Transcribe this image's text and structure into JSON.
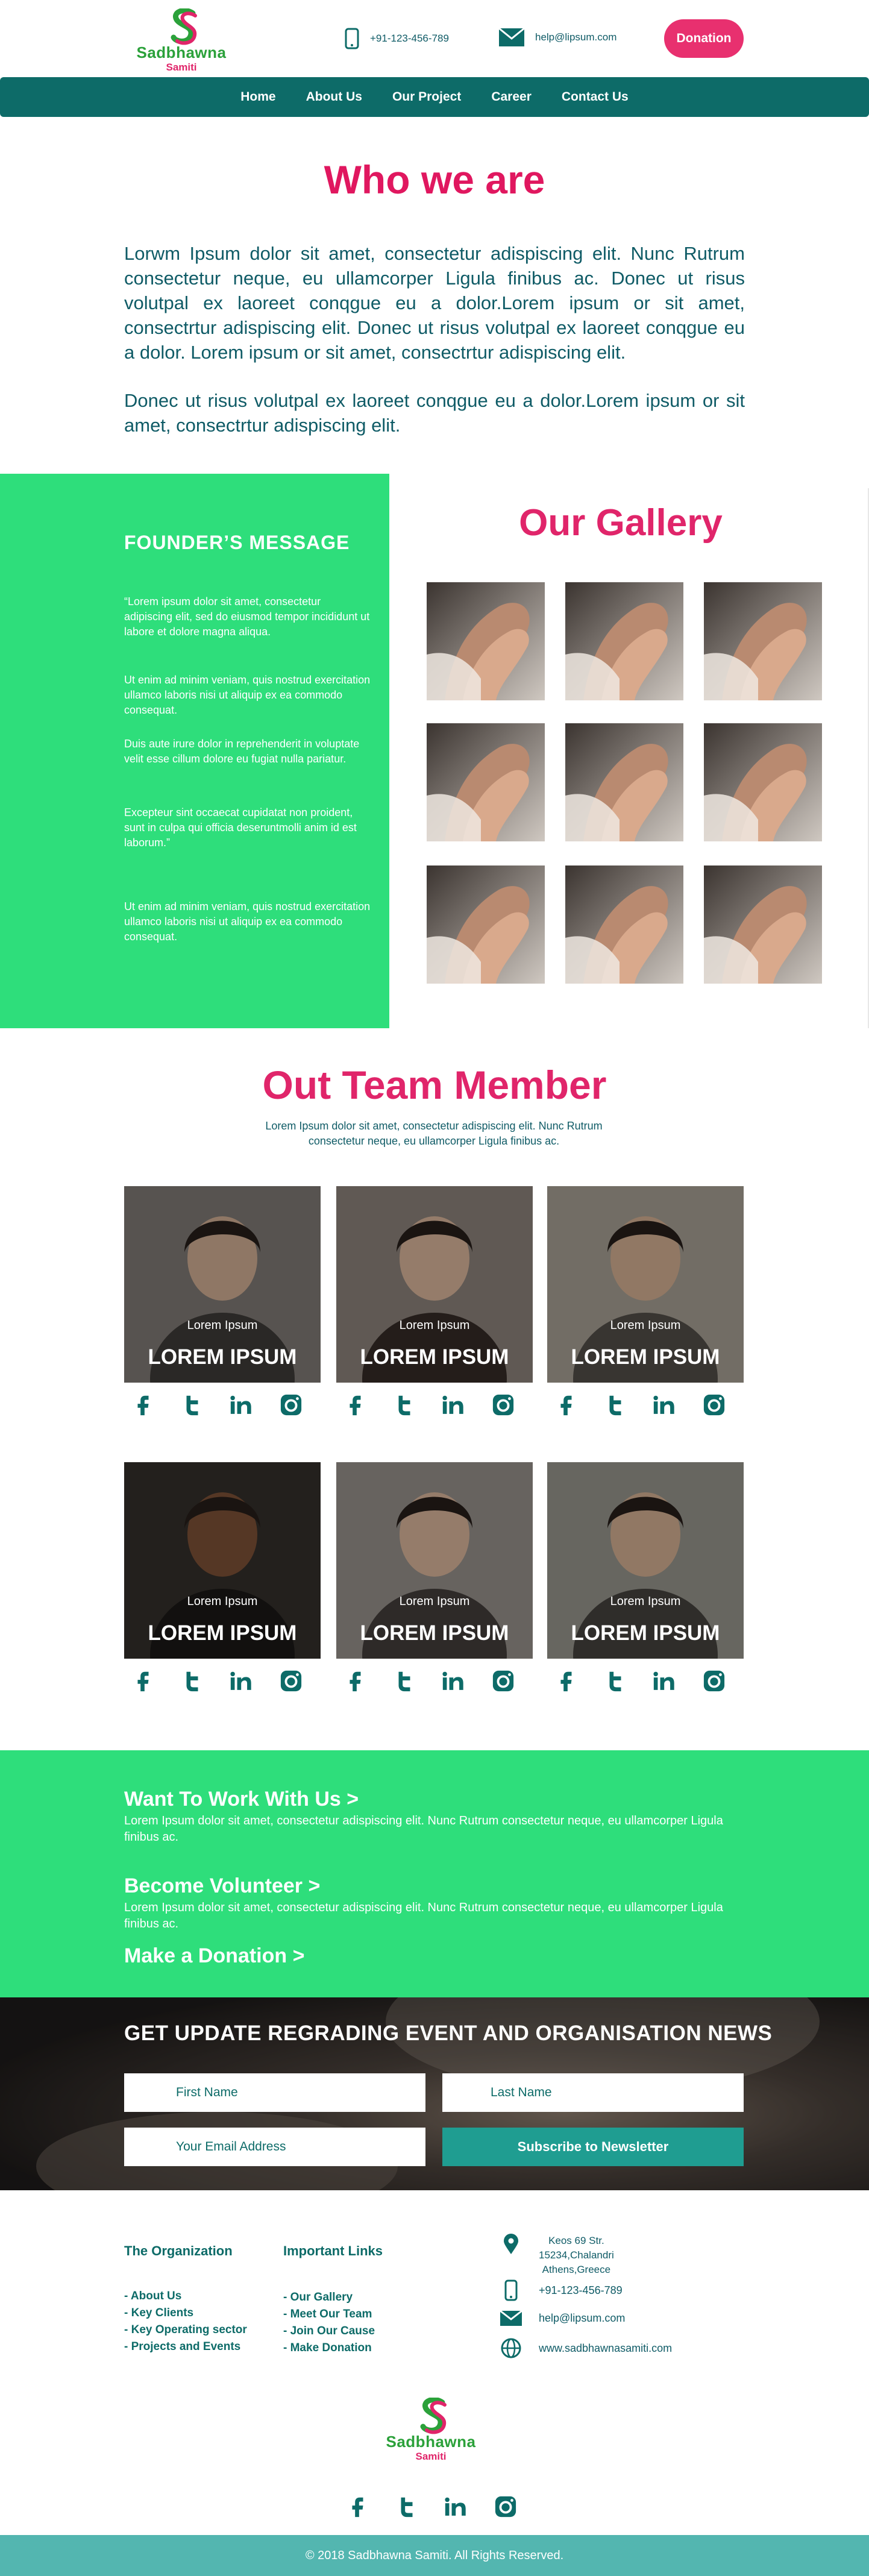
{
  "header": {
    "logo_name": "Sadbhawna",
    "logo_sub": "Samiti",
    "phone": "+91-123-456-789",
    "email": "help@lipsum.com",
    "donation_label": "Donation"
  },
  "nav": {
    "items": [
      "Home",
      "About Us",
      "Our Project",
      "Career",
      "Contact Us"
    ]
  },
  "who": {
    "title": "Who we are",
    "p1": "Lorwm Ipsum dolor sit amet, consectetur adispiscing elit. Nunc Rutrum consectetur neque, eu ullamcorper Ligula finibus ac. Donec ut risus volutpal ex laoreet conqgue eu a dolor.Lorem ipsum or sit amet, consectrtur adispiscing elit. Donec ut risus volutpal ex laoreet conqgue eu a dolor. Lorem ipsum or sit amet, consectrtur adispiscing elit.",
    "p2": "Donec ut risus volutpal ex laoreet conqgue eu a dolor.Lorem ipsum or sit amet, consectrtur adispiscing elit."
  },
  "founder": {
    "title": "FOUNDER’S MESSAGE",
    "p1": "“Lorem ipsum dolor sit amet, consectetur adipiscing elit, sed do eiusmod tempor incididunt ut labore et dolore magna aliqua.",
    "p2": "Ut enim ad minim veniam, quis nostrud exercitation ullamco laboris nisi ut aliquip ex ea commodo consequat.",
    "p3": "Duis aute irure dolor in reprehenderit in voluptate velit esse cillum dolore eu fugiat nulla pariatur.",
    "p4": "Excepteur sint occaecat cupidatat non proident, sunt in culpa qui officia deseruntmolli anim id est laborum.”",
    "p5": "Ut enim ad minim veniam, quis nostrud exercitation ullamco laboris nisi ut aliquip ex ea commodo consequat."
  },
  "gallery": {
    "title": "Our Gallery"
  },
  "team": {
    "title": "Out Team Member",
    "subtitle": "Lorem Ipsum dolor sit amet, consectetur adispiscing elit. Nunc Rutrum consectetur neque, eu ullamcorper Ligula finibus ac.",
    "members": [
      {
        "role": "Lorem Ipsum",
        "name": "LOREM IPSUM"
      },
      {
        "role": "Lorem Ipsum",
        "name": "LOREM IPSUM"
      },
      {
        "role": "Lorem Ipsum",
        "name": "LOREM IPSUM"
      },
      {
        "role": "Lorem Ipsum",
        "name": "LOREM IPSUM"
      },
      {
        "role": "Lorem Ipsum",
        "name": "LOREM IPSUM"
      },
      {
        "role": "Lorem Ipsum",
        "name": "LOREM IPSUM"
      }
    ],
    "social_icons": [
      "facebook-icon",
      "twitter-icon",
      "linkedin-icon",
      "instagram-icon"
    ]
  },
  "cta": {
    "work_title": "Want To Work With Us  >",
    "work_text": "Lorem Ipsum dolor sit amet, consectetur adispiscing elit. Nunc Rutrum consectetur neque, eu ullamcorper Ligula finibus ac.",
    "volunteer_title": "Become Volunteer  >",
    "volunteer_text": "Lorem Ipsum dolor sit amet, consectetur adispiscing elit. Nunc Rutrum consectetur neque, eu ullamcorper Ligula finibus ac.",
    "donation_title": "Make a Donation >"
  },
  "newsletter": {
    "title": "GET UPDATE REGRADING EVENT AND ORGANISATION NEWS",
    "first_name": "First Name",
    "last_name": "Last Name",
    "email": "Your Email Address",
    "button": "Subscribe to Newsletter"
  },
  "footer": {
    "org_title": "The Organization",
    "org_links": [
      "- About Us",
      "- Key Clients",
      "- Key Operating sector",
      "- Projects and Events"
    ],
    "links_title": "Important Links",
    "links": [
      "- Our Gallery",
      "- Meet Our Team",
      "- Join Our Cause",
      "- Make Donation"
    ],
    "address_l1": "Keos 69 Str.",
    "address_l2": "15234,Chalandri",
    "address_l3": "Athens,Greece",
    "phone": "+91-123-456-789",
    "email": "help@lipsum.com",
    "website": "www.sadbhawnasamiti.com",
    "logo_name": "Sadbhawna",
    "logo_sub": "Samiti",
    "copyright": "© 2018 Sadbhawna Samiti. All Rights Reserved."
  },
  "colors": {
    "teal": "#0d6b68",
    "green": "#2ede7b",
    "pink": "#e0256a"
  }
}
